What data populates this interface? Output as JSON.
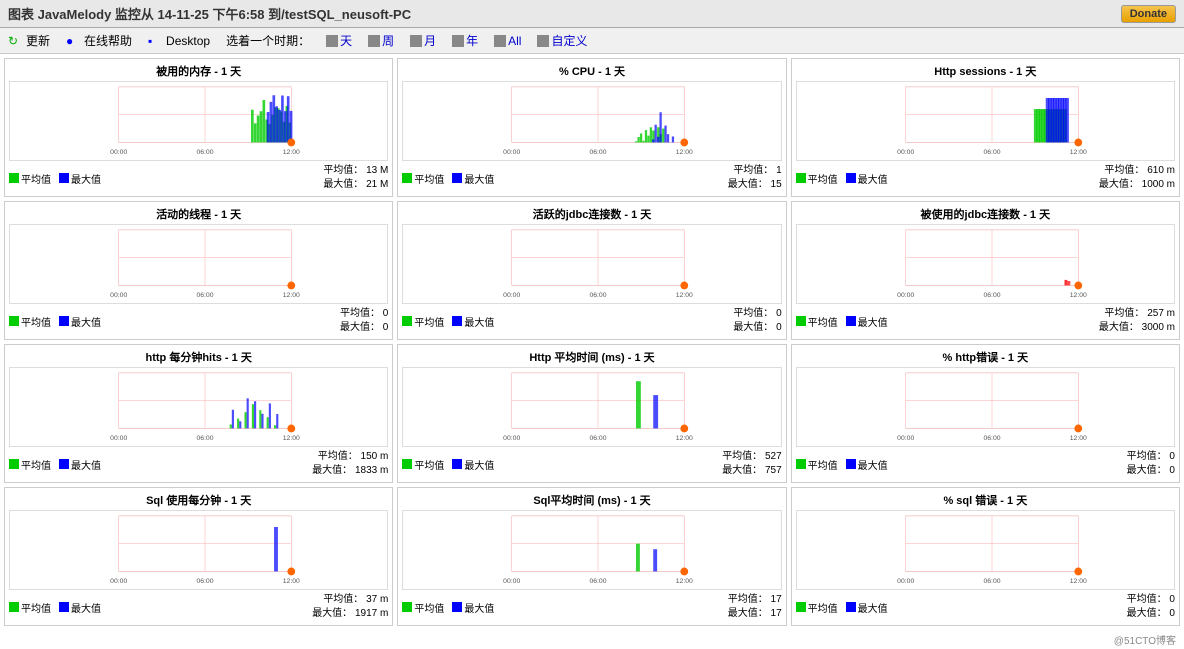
{
  "header": {
    "title": "图表 JavaMelody 监控从 14-11-25 下午6:58 到/testSQL_neusoft-PC",
    "donate_label": "Donate"
  },
  "toolbar": {
    "refresh_label": "更新",
    "help_label": "在线帮助",
    "desktop_label": "Desktop",
    "period_prefix": "选着一个时期：",
    "periods": [
      "天",
      "周",
      "月",
      "年",
      "All",
      "自定义"
    ]
  },
  "charts": [
    {
      "id": "memory",
      "title": "被用的内存 - 1 天",
      "y_max": "20 M",
      "avg_label": "平均值",
      "max_label": "最大值",
      "avg_val": "平均值：",
      "max_val": "最大值：",
      "avg_num": "13 M",
      "max_num": "21 M"
    },
    {
      "id": "cpu",
      "title": "% CPU - 1 天",
      "y_max": "20",
      "avg_label": "平均值",
      "max_label": "最大值",
      "avg_val": "平均值：",
      "max_val": "最大值：",
      "avg_num": "1",
      "max_num": "15"
    },
    {
      "id": "http-sessions",
      "title": "Http sessions - 1 天",
      "y_max": "1.0",
      "avg_label": "平均值",
      "max_label": "最大值",
      "avg_val": "平均值：",
      "max_val": "最大值：",
      "avg_num": "610 m",
      "max_num": "1000 m"
    },
    {
      "id": "active-threads",
      "title": "活动的线程 - 1 天",
      "y_max": "1.0",
      "avg_label": "平均值",
      "max_label": "最大值",
      "avg_val": "平均值：",
      "max_val": "最大值：",
      "avg_num": "0",
      "max_num": "0"
    },
    {
      "id": "active-jdbc",
      "title": "活跃的jdbc连接数 - 1 天",
      "y_max": "1.0",
      "avg_label": "平均值",
      "max_label": "最大值",
      "avg_val": "平均值：",
      "max_val": "最大值：",
      "avg_num": "0",
      "max_num": "0"
    },
    {
      "id": "used-jdbc",
      "title": "被使用的jdbc连接数 - 1 天",
      "y_max": "2.0",
      "avg_label": "平均值",
      "max_label": "最大值",
      "avg_val": "平均值：",
      "max_val": "最大值：",
      "avg_num": "257 m",
      "max_num": "3000 m"
    },
    {
      "id": "http-hits",
      "title": "http 每分钟hits - 1 天",
      "y_max": "2.0",
      "avg_label": "平均值",
      "max_label": "最大值",
      "avg_val": "平均值：",
      "max_val": "最大值：",
      "avg_num": "150 m",
      "max_num": "1833 m"
    },
    {
      "id": "http-avg-time",
      "title": "Http 平均时间 (ms) - 1 天",
      "y_max": "500",
      "avg_label": "平均值",
      "max_label": "最大值",
      "avg_val": "平均值：",
      "max_val": "最大值：",
      "avg_num": "527",
      "max_num": "757"
    },
    {
      "id": "http-errors",
      "title": "% http错误 - 1 天",
      "y_max": "1.0",
      "avg_label": "平均值",
      "max_label": "最大值",
      "avg_val": "平均值：",
      "max_val": "最大值：",
      "avg_num": "0",
      "max_num": "0"
    },
    {
      "id": "sql-hits",
      "title": "Sql 使用每分钟 - 1 天",
      "y_max": "2.0",
      "avg_label": "平均值",
      "max_label": "最大值",
      "avg_val": "平均值：",
      "max_val": "最大值：",
      "avg_num": "37 m",
      "max_num": "1917 m"
    },
    {
      "id": "sql-avg-time",
      "title": "Sql平均时间 (ms) - 1 天",
      "y_max": "20",
      "avg_label": "平均值",
      "max_label": "最大值",
      "avg_val": "平均值：",
      "max_val": "最大值：",
      "avg_num": "17",
      "max_num": "17"
    },
    {
      "id": "sql-errors",
      "title": "% sql 错误 - 1 天",
      "y_max": "1.0",
      "avg_label": "平均值",
      "max_label": "最大值",
      "avg_val": "平均值：",
      "max_val": "最大值：",
      "avg_num": "0",
      "max_num": "0"
    }
  ],
  "footer": {
    "credit": "@51CTO博客"
  }
}
